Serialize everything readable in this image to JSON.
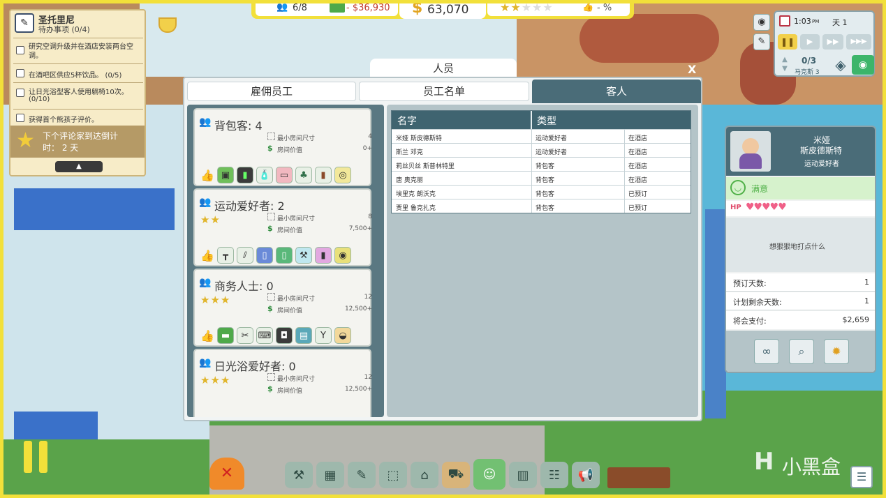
{
  "topbar": {
    "guests": "6/8",
    "expense": "- $36,930",
    "money": "63,070",
    "rating_stars": 2,
    "approval": "- %"
  },
  "tasks": {
    "location": "圣托里尼",
    "todo": "待办事项 (0/4)",
    "items": [
      {
        "text": "研究空调升级并在酒店安装两台空调。",
        "progress": ""
      },
      {
        "text": "在酒吧区供应5杯饮品。 (0/5)",
        "progress": ""
      },
      {
        "text": "让日光浴型客人使用躺椅10次。",
        "progress": "(0/10)"
      },
      {
        "text": "获得首个熊孩子评价。",
        "progress": ""
      }
    ],
    "critic_label": "下个评论家到达倒计",
    "critic_time": "时：  2 天"
  },
  "clock": {
    "time": "1:03",
    "ampm": "PM",
    "day": "天 1",
    "floor_count": "0/3",
    "floor_name": "马克斯 3"
  },
  "dialog": {
    "title": "人员",
    "close": "X",
    "tabs": [
      "雇佣员工",
      "员工名单",
      "客人"
    ],
    "active_tab": 2
  },
  "guest_types": [
    {
      "name": "背包客: 4",
      "stars": 0,
      "min_room_label": "最小房间尺寸",
      "min_room": "4",
      "price_label": "房间价值",
      "price": "0+",
      "icons": [
        "gaming-machine-icon",
        "arcade-icon",
        "soap-dispenser-icon",
        "yoga-mat-icon",
        "tree-icon",
        "snacks-icon",
        "food-plate-icon"
      ]
    },
    {
      "name": "运动爱好者: 2",
      "stars": 2,
      "min_room_label": "最小房间尺寸",
      "min_room": "8",
      "price_label": "房间价值",
      "price": "7,500+",
      "icons": [
        "pullup-bar-icon",
        "treadmill-icon",
        "locker-icon",
        "drink-machine-icon",
        "dumbbell-icon",
        "protein-drink-icon",
        "salad-icon"
      ]
    },
    {
      "name": "商务人士: 0",
      "stars": 3,
      "min_room_label": "最小房间尺寸",
      "min_room": "12",
      "price_label": "房间价值",
      "price": "12,500+",
      "icons": [
        "cash-icon",
        "cocktail-tray-icon",
        "laptop-icon",
        "speaker-icon",
        "chairs-icon",
        "martini-icon",
        "burger-icon"
      ]
    },
    {
      "name": "日光浴爱好者: 0",
      "stars": 3,
      "min_room_label": "最小房间尺寸",
      "min_room": "12",
      "price_label": "房间价值",
      "price": "12,500+",
      "icons": []
    }
  ],
  "guest_table": {
    "headers": [
      "名字",
      "类型"
    ],
    "rows": [
      [
        "米娅 斯皮德斯特",
        "运动爱好者",
        "在酒店"
      ],
      [
        "斯兰 邓克",
        "运动爱好者",
        "在酒店"
      ],
      [
        "莉丝贝丝 斯普林特里",
        "背包客",
        "在酒店"
      ],
      [
        "唐 奥克丽",
        "背包客",
        "在酒店"
      ],
      [
        "埃里克 朗沃克",
        "背包客",
        "已预订"
      ],
      [
        "贾里 鲁克扎克",
        "背包客",
        "已预订"
      ]
    ]
  },
  "guest_detail": {
    "first_name": "米娅",
    "last_name": "斯皮德斯特",
    "type": "运动爱好者",
    "mood": "满意",
    "hp_label": "HP",
    "hearts": 5,
    "thought": "想狠狠地打点什么",
    "stats": [
      {
        "label": "预订天数:",
        "value": "1"
      },
      {
        "label": "计划剩余天数:",
        "value": "1"
      },
      {
        "label": "将会支付:",
        "value": "$2,659"
      }
    ]
  },
  "watermark": "小黑盒",
  "colors": {
    "frame": "#f2e03a",
    "header": "#3f6470",
    "panel": "#5a7882",
    "tab_active": "#4a6c78",
    "money": "#2e8b3c",
    "expense": "#c0392b"
  }
}
